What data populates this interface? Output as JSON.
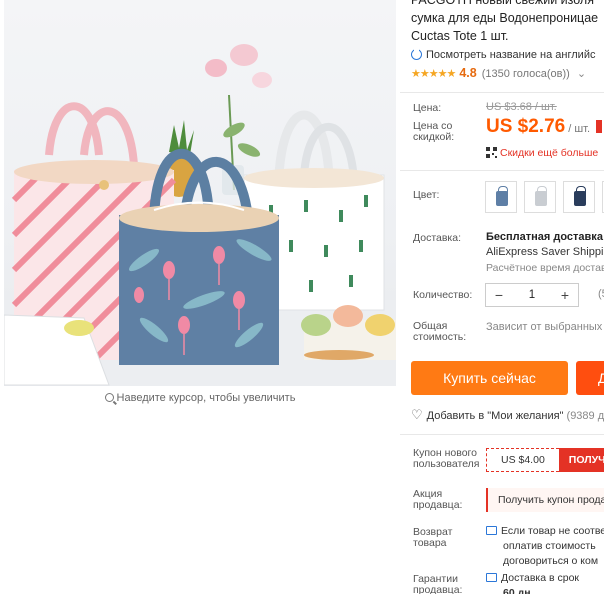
{
  "product": {
    "title_lines": [
      "PACGOTH новый свежий изоля",
      "сумка для еды Водонепроницае",
      "Cuctas Tote 1 шт."
    ],
    "translate_link": "Посмотреть название на английс",
    "rating": "4.8",
    "votes": "(1350 голоса(ов))"
  },
  "image": {
    "zoom_hint": "Наведите курсор, чтобы увеличить"
  },
  "price": {
    "label": "Цена:",
    "old": "US $3.68 / шт.",
    "discount_label": "Цена со скидкой:",
    "new": "US $2.76",
    "unit": "/ шт.",
    "discount_text": "Скидки ещё больше"
  },
  "color": {
    "label": "Цвет:",
    "options": [
      {
        "icon": "bag-thumbnail-icon",
        "color": "#5e7fa6"
      },
      {
        "icon": "bag-thumbnail-icon",
        "color": "#c9cdd2"
      },
      {
        "icon": "bag-thumbnail-icon",
        "color": "#2a3d5c"
      },
      {
        "icon": "bag-thumbnail-icon",
        "color": "#7a8fa8"
      }
    ]
  },
  "shipping": {
    "label": "Доставка:",
    "line1": "Бесплатная доставка в",
    "line2": "AliExpress Saver Shippi",
    "line3": "Расчётное время доставк"
  },
  "quantity": {
    "label": "Количество:",
    "minus": "−",
    "value": "1",
    "plus": "+",
    "extra": "(5"
  },
  "total": {
    "label": "Общая стоимость:",
    "value": "Зависит от выбранных т"
  },
  "buttons": {
    "buy_now": "Купить сейчас",
    "add_to_cart": "Д"
  },
  "wishlist": {
    "label": "Добавить в \"Мои желания\"",
    "count": "(9389 д"
  },
  "coupon": {
    "label": "Купон нового пользователя",
    "amount": "US $4.00",
    "action": "ПОЛУЧ"
  },
  "promo": {
    "label": "Акция продавца:",
    "text": "Получить купон прода"
  },
  "returns": {
    "label": "Возврат товара",
    "lines": [
      "Если товар не соотве",
      "оплатив стоимость",
      "договориться о ком"
    ]
  },
  "guarantee": {
    "label": "Гарантии продавца:",
    "line1": "Доставка в срок",
    "line2": "60 дн"
  },
  "colors": {
    "accent": "#ff5a00",
    "buy": "#ff7a14",
    "cart": "#ff4e0f",
    "red": "#e43225",
    "star": "#f5a623",
    "link": "#2b77d8"
  }
}
